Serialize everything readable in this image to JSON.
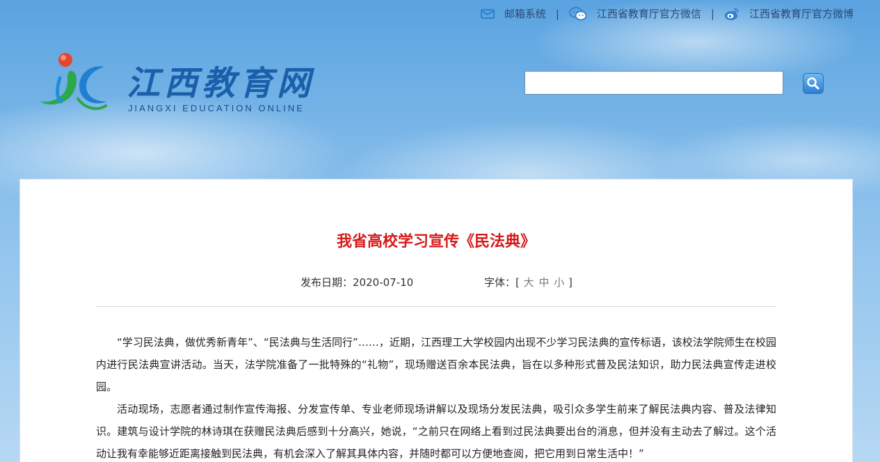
{
  "topbar": {
    "mail_label": "邮箱系统",
    "wechat_label": "江西省教育厅官方微信",
    "weibo_label": "江西省教育厅官方微博",
    "separator": "|"
  },
  "logo": {
    "name_cn": "江西教育网",
    "name_en": "JIANGXI EDUCATION ONLINE"
  },
  "search": {
    "value": "",
    "placeholder": ""
  },
  "article": {
    "title": "我省高校学习宣传《民法典》",
    "date_label": "发布日期：",
    "date_value": "2020-07-10",
    "font_label": "字体：",
    "bracket_open": "[",
    "bracket_close": "]",
    "font_large": "大",
    "font_medium": "中",
    "font_small": "小",
    "paragraphs": [
      "“学习民法典，做优秀新青年”、“民法典与生活同行”……，近期，江西理工大学校园内出现不少学习民法典的宣传标语，该校法学院师生在校园内进行民法典宣讲活动。当天，法学院准备了一批特殊的“礼物”，现场赠送百余本民法典，旨在以多种形式普及民法知识，助力民法典宣传走进校园。",
      "活动现场，志愿者通过制作宣传海报、分发宣传单、专业老师现场讲解以及现场分发民法典，吸引众多学生前来了解民法典内容、普及法律知识。建筑与设计学院的林诗琪在获赠民法典后感到十分高兴，她说，“之前只在网络上看到过民法典要出台的消息，但并没有主动去了解过。这个活动让我有幸能够近距离接触到民法典，有机会深入了解其具体内容，并随时都可以方便地查阅，把它用到日常生活中！”"
    ]
  },
  "colors": {
    "title_red": "#d61a1a",
    "logo_blue": "#1a5faa",
    "link_navy": "#2b4a74"
  },
  "icons": {
    "mail": "mail-icon",
    "wechat": "wechat-icon",
    "weibo": "weibo-icon",
    "search": "search-icon"
  }
}
